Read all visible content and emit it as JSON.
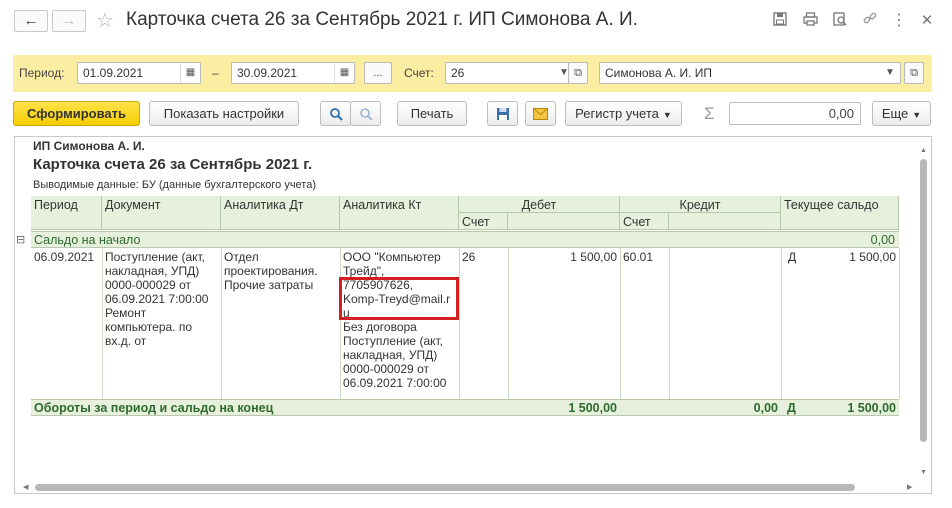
{
  "window": {
    "title": "Карточка счета 26 за Сентябрь 2021 г. ИП Симонова А. И.",
    "back_icon": "←",
    "forward_icon": "→",
    "star_icon": "☆",
    "close_icon": "✕",
    "more_icon": "⋮",
    "link_icon": "🔗"
  },
  "filter": {
    "period_label": "Период:",
    "date_from": "01.09.2021",
    "dash": "–",
    "date_to": "30.09.2021",
    "ellipsis": "...",
    "account_label": "Счет:",
    "account_value": "26",
    "org_value": "Симонова А. И. ИП"
  },
  "toolbar": {
    "generate": "Сформировать",
    "show_settings": "Показать настройки",
    "print": "Печать",
    "register": "Регистр учета",
    "sigma": "Σ",
    "sum_value": "0,00",
    "more": "Еще"
  },
  "report": {
    "org_name": "ИП Симонова А. И.",
    "heading": "Карточка счета 26 за Сентябрь 2021 г.",
    "data_shown": "Выводимые данные:  БУ (данные бухгалтерского учета)",
    "columns": {
      "period": "Период",
      "document": "Документ",
      "analytics_dt": "Аналитика Дт",
      "analytics_kt": "Аналитика Кт",
      "debit": "Дебет",
      "credit": "Кредит",
      "balance": "Текущее сальдо",
      "account_dt": "Счет",
      "account_kt": "Счет"
    },
    "opening": {
      "label": "Сальдо на начало",
      "value": "0,00",
      "toggle": "⊟"
    },
    "row": {
      "date": "06.09.2021",
      "doc_lines": [
        "Поступление (акт,",
        "накладная, УПД)",
        "0000-000029 от",
        "06.09.2021 7:00:00",
        "Ремонт",
        "компьютера. по",
        "вх.д.  от"
      ],
      "dt_lines": [
        "Отдел",
        "проектирования.",
        "Прочие затраты"
      ],
      "kt_lines": [
        "ООО \"Компьютер",
        "Трейд\",",
        "7705907626,",
        "Komp-Treyd@mail.r",
        "u",
        "Без договора",
        "Поступление (акт,",
        "накладная, УПД)",
        "0000-000029 от",
        "06.09.2021 7:00:00"
      ],
      "debit_account": "26",
      "debit_amount": "1 500,00",
      "credit_account": "60.01",
      "balance_side": "Д",
      "balance_amount": "1 500,00"
    },
    "totals": {
      "label": "Обороты за период и сальдо на конец",
      "debit": "1 500,00",
      "credit": "0,00",
      "side": "Д",
      "balance": "1 500,00"
    }
  }
}
